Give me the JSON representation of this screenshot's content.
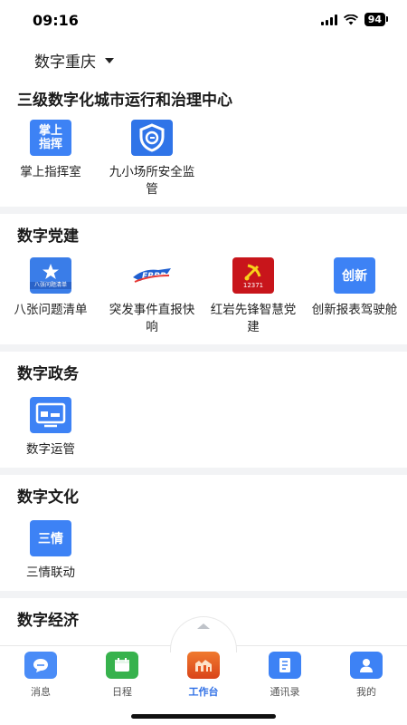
{
  "status_bar": {
    "time": "09:16",
    "battery": "94"
  },
  "header": {
    "city": "数字重庆"
  },
  "sections": [
    {
      "title": "三级数字化城市运行和治理中心",
      "items": [
        {
          "label": "掌上指挥室",
          "icon": "command-room-icon",
          "icon_text": "掌上\n指挥"
        },
        {
          "label": "九小场所安全监管",
          "icon": "shield-icon"
        }
      ]
    },
    {
      "title": "数字党建",
      "items": [
        {
          "label": "八张问题清单",
          "icon": "problem-list-icon",
          "icon_text": "八张问题清单"
        },
        {
          "label": "突发事件直报快响",
          "icon": "emergency-report-icon",
          "icon_text": "ERRR"
        },
        {
          "label": "红岩先锋智慧党建",
          "icon": "party-emblem-icon",
          "icon_text": "12371"
        },
        {
          "label": "创新报表驾驶舱",
          "icon": "innovation-report-icon",
          "icon_text": "创新"
        }
      ]
    },
    {
      "title": "数字政务",
      "items": [
        {
          "label": "数字运管",
          "icon": "monitor-icon"
        }
      ]
    },
    {
      "title": "数字文化",
      "items": [
        {
          "label": "三情联动",
          "icon": "three-feelings-icon",
          "icon_text": "三情"
        }
      ]
    },
    {
      "title": "数字经济",
      "items": []
    }
  ],
  "tabs": [
    {
      "label": "消息",
      "icon": "message-icon",
      "color": "#4a8cf7"
    },
    {
      "label": "日程",
      "icon": "calendar-icon",
      "color": "#37b24d"
    },
    {
      "label": "工作台",
      "icon": "workbench-icon",
      "color": "#e8551f",
      "active": true
    },
    {
      "label": "通讯录",
      "icon": "contacts-icon",
      "color": "#3d82f5"
    },
    {
      "label": "我的",
      "icon": "user-icon",
      "color": "#3d82f5"
    }
  ],
  "colors": {
    "accent": "#2f6fe6",
    "icon_blue": "#3d82f5",
    "party_red": "#c8151b"
  }
}
